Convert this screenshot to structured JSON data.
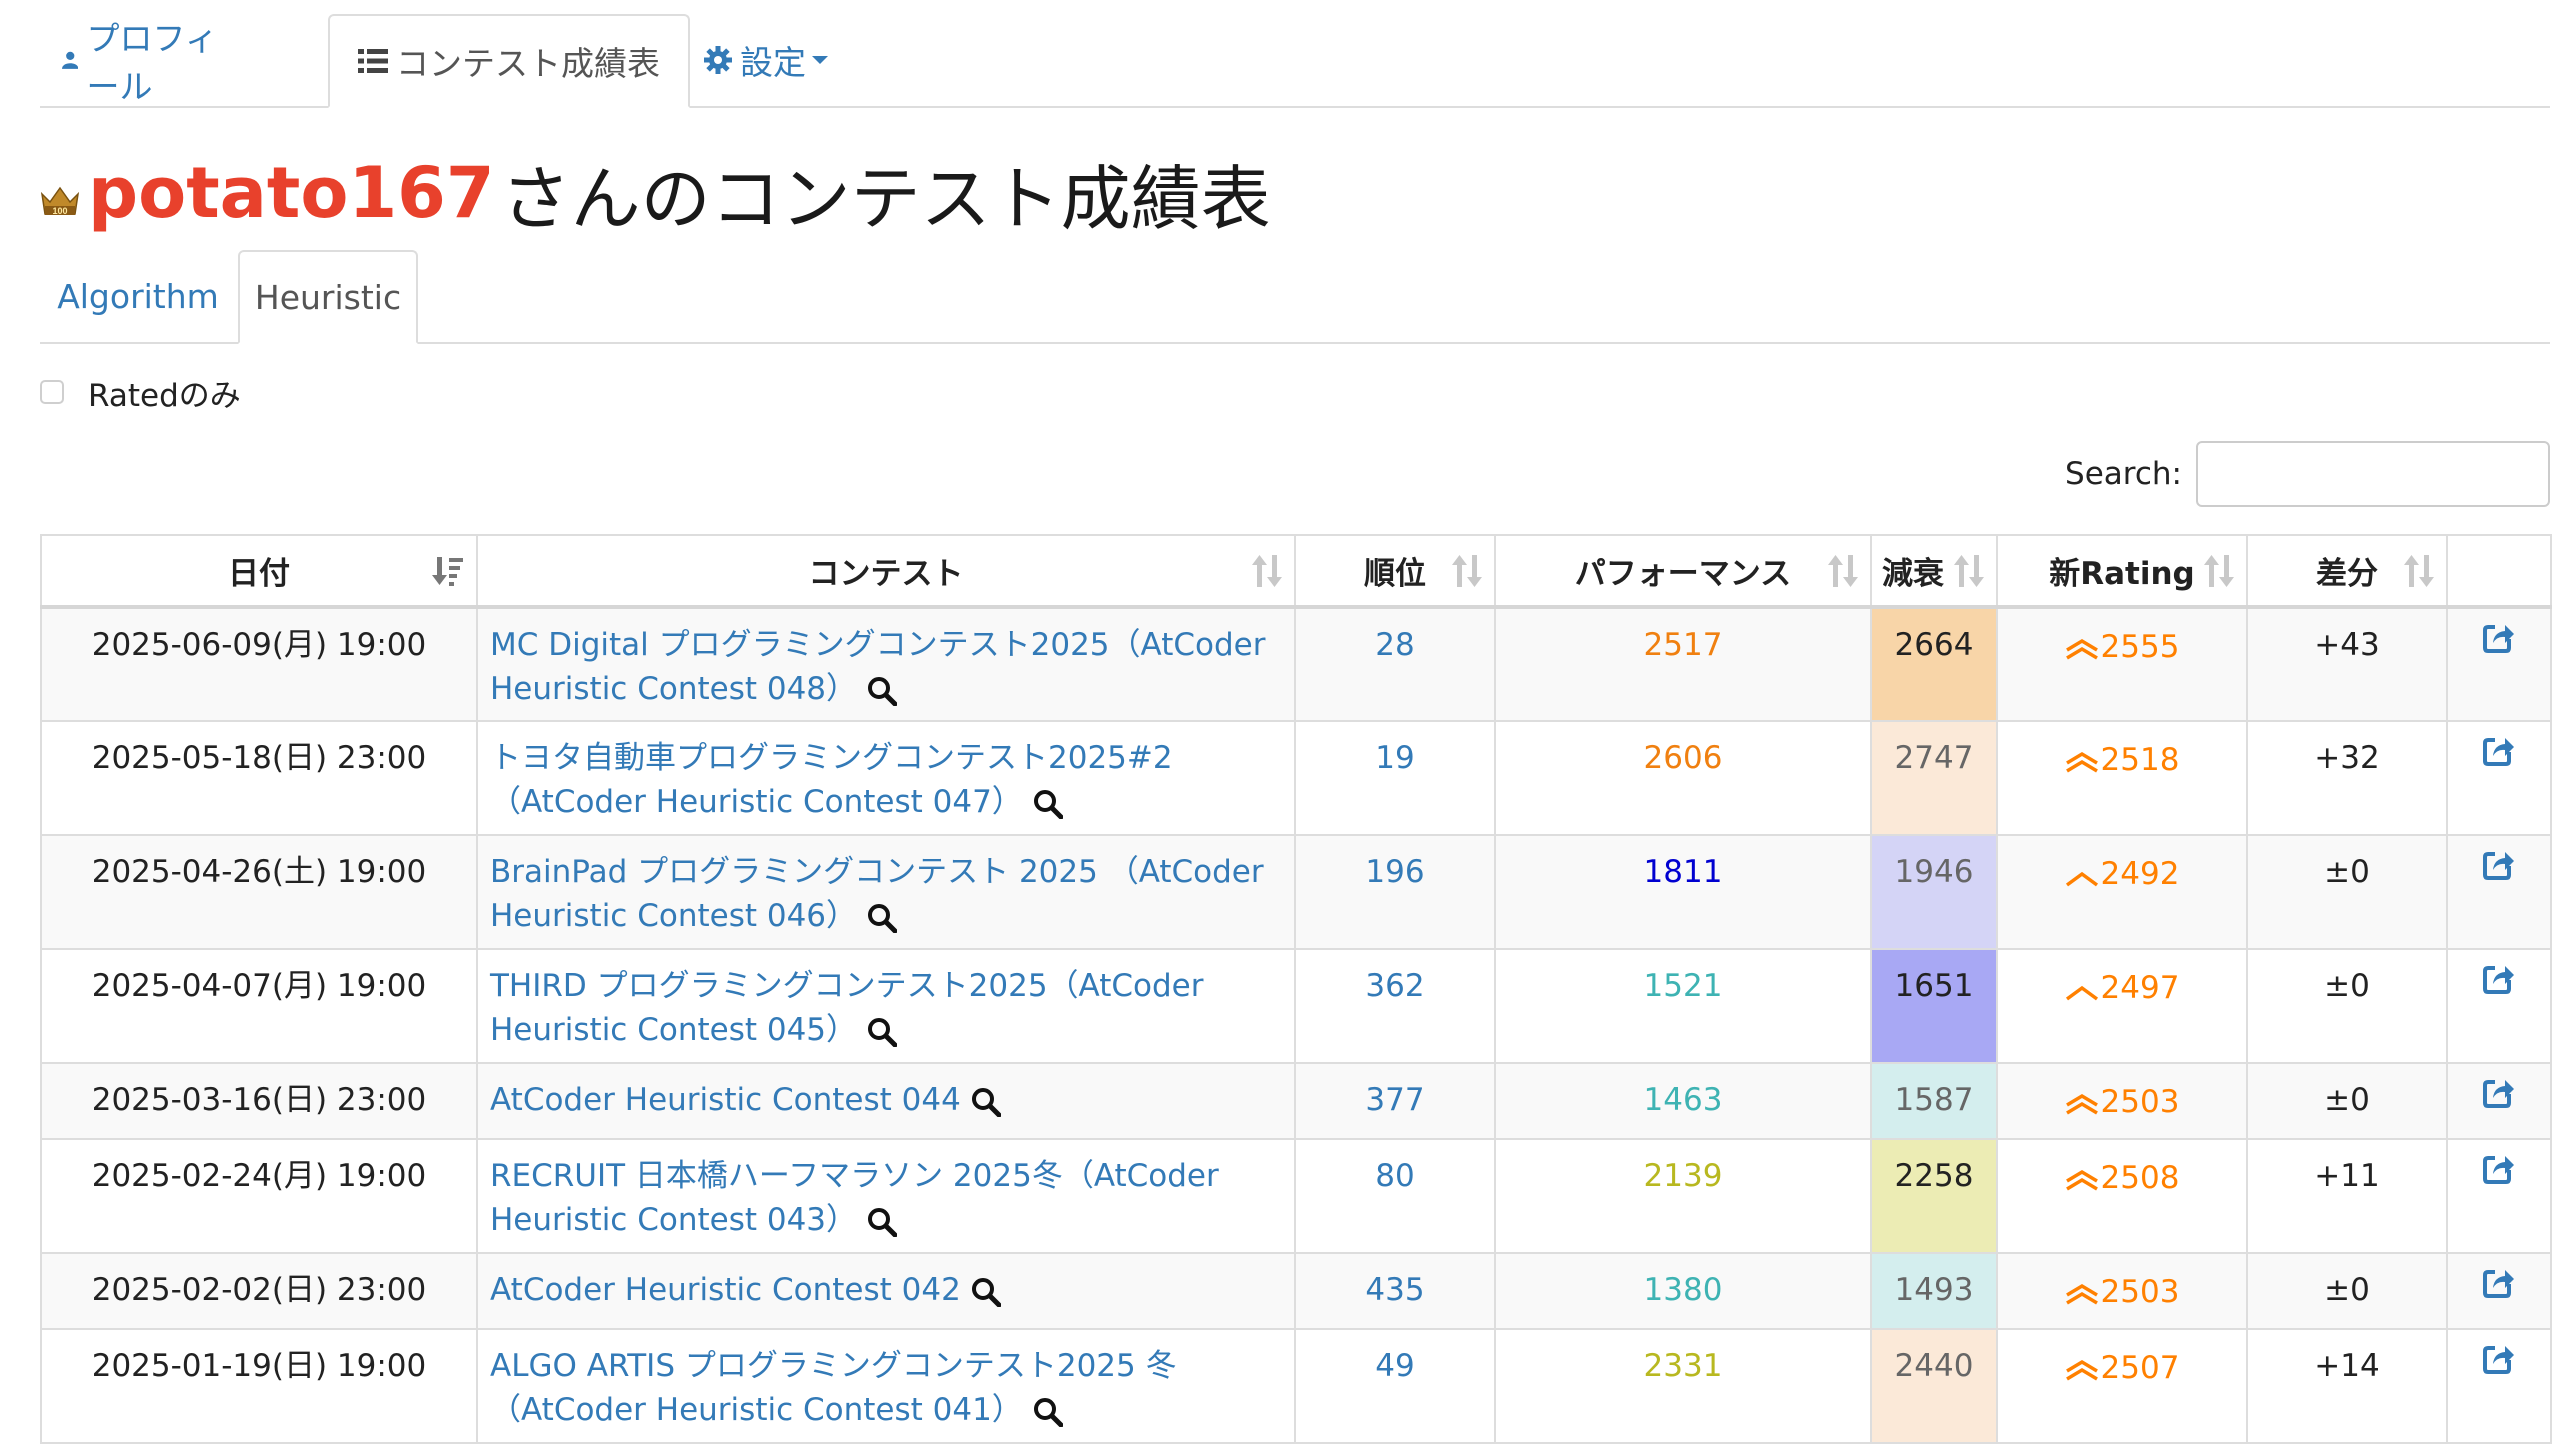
{
  "nav": {
    "tabs": [
      {
        "label": "プロフィール",
        "icon": "user-icon"
      },
      {
        "label": "コンテスト成績表",
        "icon": "list-icon"
      },
      {
        "label": "設定",
        "icon": "gear-icon"
      }
    ]
  },
  "heading": {
    "username": "potato167",
    "suffix": "さんのコンテスト成績表",
    "crown_badge": "100"
  },
  "subtabs": [
    {
      "label": "Algorithm"
    },
    {
      "label": "Heuristic"
    }
  ],
  "filter": {
    "rated_only_label": "Ratedのみ"
  },
  "search": {
    "label": "Search:",
    "value": ""
  },
  "table": {
    "headers": [
      "日付",
      "コンテスト",
      "順位",
      "パフォーマンス",
      "減衰",
      "新Rating",
      "差分",
      ""
    ],
    "rows": [
      {
        "date": "2025-06-09(月) 19:00",
        "contest_line1": "MC Digital プログラミングコンテスト2025（AtCoder",
        "contest_line2": "Heuristic Contest 048）",
        "rank": "28",
        "perf": "2517",
        "perf_color": "#f08010",
        "decay": "2664",
        "decay_bg": "#f8d5a8",
        "decay_color": "#222222",
        "rating": "2555",
        "rating_icon": "double-chevron-up-icon",
        "diff": "+43"
      },
      {
        "date": "2025-05-18(日) 23:00",
        "contest_line1": "トヨタ自動車プログラミングコンテスト2025#2",
        "contest_line2": "（AtCoder Heuristic Contest 047）",
        "rank": "19",
        "perf": "2606",
        "perf_color": "#f08010",
        "decay": "2747",
        "decay_bg": "#fbe9d8",
        "decay_color": "#666666",
        "rating": "2518",
        "rating_icon": "double-chevron-up-icon",
        "diff": "+32"
      },
      {
        "date": "2025-04-26(土) 19:00",
        "contest_line1": "BrainPad プログラミングコンテスト 2025 （AtCoder",
        "contest_line2": "Heuristic Contest 046）",
        "rank": "196",
        "perf": "1811",
        "perf_color": "#0000d0",
        "decay": "1946",
        "decay_bg": "#d4d4f6",
        "decay_color": "#666666",
        "rating": "2492",
        "rating_icon": "chevron-up-icon",
        "diff": "±0"
      },
      {
        "date": "2025-04-07(月) 19:00",
        "contest_line1": "THIRD プログラミングコンテスト2025（AtCoder",
        "contest_line2": "Heuristic Contest 045）",
        "rank": "362",
        "perf": "1521",
        "perf_color": "#3eb3b3",
        "decay": "1651",
        "decay_bg": "#a8a8f4",
        "decay_color": "#222222",
        "rating": "2497",
        "rating_icon": "chevron-up-icon",
        "diff": "±0"
      },
      {
        "date": "2025-03-16(日) 23:00",
        "contest_line1": "AtCoder Heuristic Contest 044",
        "contest_line2": "",
        "rank": "377",
        "perf": "1463",
        "perf_color": "#3eb3b3",
        "decay": "1587",
        "decay_bg": "#d4eeee",
        "decay_color": "#666666",
        "rating": "2503",
        "rating_icon": "double-chevron-up-icon",
        "diff": "±0"
      },
      {
        "date": "2025-02-24(月) 19:00",
        "contest_line1": "RECRUIT 日本橋ハーフマラソン 2025冬（AtCoder",
        "contest_line2": "Heuristic Contest 043）",
        "rank": "80",
        "perf": "2139",
        "perf_color": "#b8b820",
        "decay": "2258",
        "decay_bg": "#ececb4",
        "decay_color": "#222222",
        "rating": "2508",
        "rating_icon": "double-chevron-up-icon",
        "diff": "+11"
      },
      {
        "date": "2025-02-02(日) 23:00",
        "contest_line1": "AtCoder Heuristic Contest 042",
        "contest_line2": "",
        "rank": "435",
        "perf": "1380",
        "perf_color": "#3eb3b3",
        "decay": "1493",
        "decay_bg": "#d4eeee",
        "decay_color": "#666666",
        "rating": "2503",
        "rating_icon": "double-chevron-up-icon",
        "diff": "±0"
      },
      {
        "date": "2025-01-19(日) 19:00",
        "contest_line1": "ALGO ARTIS プログラミングコンテスト2025 冬",
        "contest_line2": "（AtCoder Heuristic Contest 041）",
        "rank": "49",
        "perf": "2331",
        "perf_color": "#b8b820",
        "decay": "2440",
        "decay_bg": "#fbe9d8",
        "decay_color": "#666666",
        "rating": "2507",
        "rating_icon": "double-chevron-up-icon",
        "diff": "+14"
      }
    ]
  }
}
